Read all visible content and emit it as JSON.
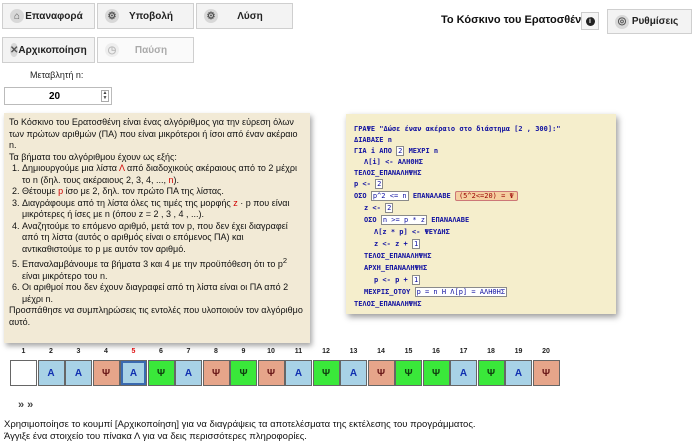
{
  "toolbar": {
    "reset": "Επαναφορά",
    "submit": "Υποβολή",
    "solution": "Λύση",
    "init": "Αρχικοποίηση",
    "pause": "Παύση",
    "settings": "Ρυθμίσεις"
  },
  "app_title": "Το Κόσκινο του Ερατοσθένη",
  "variable": {
    "label": "Μεταβλητή n:",
    "value": "20"
  },
  "description": {
    "intro": "Το Κόσκινο του Ερατοσθένη είναι ένας αλγόριθμος για την εύρεση όλων των πρώτων αριθμών (ΠΑ) που είναι μικρότεροι ή ίσοι από έναν ακέραιο n.",
    "steps_heading": "Τα βήματα του αλγόριθμου έχουν ως εξής:",
    "s1a": "Δημιουργούμε μια λίστα ",
    "s1b": "Λ",
    "s1c": " από διαδοχικούς ακέραιους από το 2 μέχρι το n (δηλ. τους ακέραιους 2, 3, 4, ..., ",
    "s1d": "n",
    "s1e": ").",
    "s2a": "Θέτουμε ",
    "s2b": "p",
    "s2c": " ίσο με 2, δηλ. τον πρώτο ΠΑ της λίστας.",
    "s3a": "Διαγράφουμε από τη λίστα όλες τις τιμές της μορφής ",
    "s3b": "z",
    "s3c": " · p που είναι μικρότερες ή ίσες με n (όπου z = 2 , 3 , 4 , ...).",
    "s4": "Αναζητούμε το επόμενο αριθμό, μετά τον p, που δεν έχει διαγραφεί από τη λίστα (αυτός ο αριθμός είναι ο επόμενος ΠΑ) και αντικαθιστούμε το p με αυτόν τον αριθμό.",
    "s5a": "Επαναλαμβάνουμε τα βήματα 3 και 4 με την προϋπόθεση ότι το p",
    "s5b": "2",
    "s5c": " είναι μικρότερο του n.",
    "s6": "Οι αριθμοί που δεν έχουν διαγραφεί από τη λίστα είναι οι ΠΑ από 2 μέχρι n.",
    "outro": "Προσπάθησε να συμπληρώσεις τις εντολές που υλοποιούν τον αλγόριθμο αυτό."
  },
  "code": {
    "l1": "ΓΡΑΨΕ \"Δώσε έναν ακέραιο στο διάστημα [2 , 300]:\"",
    "l2": "ΔΙΑΒΑΣΕ n",
    "l3a": "ΓΙΑ i ΑΠΟ",
    "l3b": "2",
    "l3c": "ΜΕΧΡΙ n",
    "l4": "Λ[i] <- ΑΛΗΘΗΣ",
    "l5": "ΤΕΛΟΣ_ΕΠΑΝΑΛΗΨΗΣ",
    "l6a": "p <-",
    "l6b": "2",
    "l7a": "ΟΣΟ",
    "l7b": "p^2 <= n",
    "l7c": "ΕΠΑΝΑΛΑΒΕ",
    "l7d": "(5^2<=20) = Ψ",
    "l8a": "z <-",
    "l8b": "2",
    "l9a": "ΟΣΟ",
    "l9b": "n >= p * z",
    "l9c": "ΕΠΑΝΑΛΑΒΕ",
    "l10": "Λ[z * p] <- ΨΕΥΔΗΣ",
    "l11a": "z <- z +",
    "l11b": "1",
    "l12": "ΤΕΛΟΣ_ΕΠΑΝΑΛΗΨΗΣ",
    "l13": "ΑΡΧΗ_ΕΠΑΝΑΛΗΨΗΣ",
    "l14a": "p <- p +",
    "l14b": "1",
    "l15a": "ΜΕΧΡΙΣ_ΟΤΟΥ",
    "l15b": "p = n Η Λ[p] = ΑΛΗΘΗΣ",
    "l16": "ΤΕΛΟΣ_ΕΠΑΝΑΛΗΨΗΣ"
  },
  "cells": {
    "numbers": [
      "1",
      "2",
      "3",
      "4",
      "5",
      "6",
      "7",
      "8",
      "9",
      "10",
      "11",
      "12",
      "13",
      "14",
      "15",
      "16",
      "17",
      "18",
      "19",
      "20"
    ],
    "values": [
      "",
      "Α",
      "Α",
      "Ψ",
      "Α",
      "Ψ",
      "Α",
      "Ψ",
      "Ψ",
      "Ψ",
      "Α",
      "Ψ",
      "Α",
      "Ψ",
      "Ψ",
      "Ψ",
      "Α",
      "Ψ",
      "Α",
      "Ψ"
    ],
    "kinds": [
      "E",
      "A",
      "A",
      "P",
      "A",
      "G",
      "A",
      "P",
      "G",
      "P",
      "A",
      "G",
      "A",
      "P",
      "G",
      "G",
      "A",
      "G",
      "A",
      "P"
    ],
    "highlighted_index": 4
  },
  "nav_arrows": "» »",
  "footer": {
    "line1": "Χρησιμοποίησε το κουμπί [Αρχικοποίηση] για να διαγράψεις τα αποτελέσματα της εκτέλεσης του προγράμματος.",
    "line2": "Άγγιξε ένα στοιχείο του πίνακα Λ για να δεις περισσότερες πληροφορίες."
  },
  "icons": {
    "reset": "home-icon",
    "submit": "gear-icon",
    "solution": "gear-icon",
    "init": "close-icon",
    "pause": "clock-icon",
    "settings": "globe-icon",
    "info": "info-icon"
  }
}
